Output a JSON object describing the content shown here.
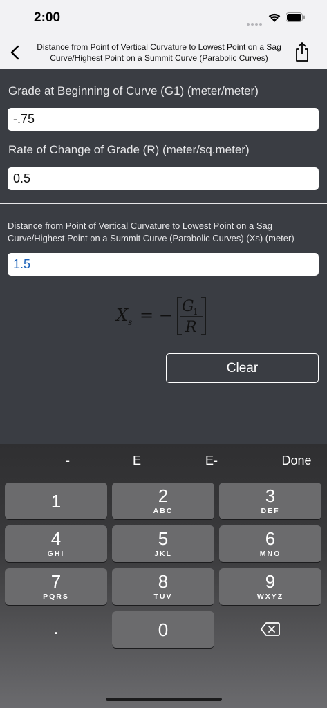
{
  "status_bar": {
    "time": "2:00"
  },
  "nav": {
    "title": "Distance from Point of Vertical Curvature to Lowest Point on a Sag Curve/Highest Point on a Summit Curve (Parabolic Curves)"
  },
  "form": {
    "g1_label": "Grade at Beginning of Curve (G1) (meter/meter)",
    "g1_value": "-.75",
    "r_label": "Rate of Change of Grade (R) (meter/sq.meter)",
    "r_value": "0.5",
    "result_label": "Distance from Point of Vertical Curvature to Lowest Point on a Sag Curve/Highest Point on a Summit Curve (Parabolic Curves) (Xs) (meter)",
    "result_value": "1.5",
    "clear_label": "Clear"
  },
  "formula": {
    "lhs": "X",
    "lhs_sub": "s",
    "eq": "= −",
    "num": "G",
    "num_sub": "1",
    "den": "R"
  },
  "keyboard": {
    "accessory": [
      "-",
      "E",
      "E-",
      "Done"
    ],
    "keys": [
      {
        "digit": "1",
        "letters": ""
      },
      {
        "digit": "2",
        "letters": "ABC"
      },
      {
        "digit": "3",
        "letters": "DEF"
      },
      {
        "digit": "4",
        "letters": "GHI"
      },
      {
        "digit": "5",
        "letters": "JKL"
      },
      {
        "digit": "6",
        "letters": "MNO"
      },
      {
        "digit": "7",
        "letters": "PQRS"
      },
      {
        "digit": "8",
        "letters": "TUV"
      },
      {
        "digit": "9",
        "letters": "WXYZ"
      }
    ],
    "dot": ".",
    "zero": "0",
    "delete_icon": "backspace-icon"
  }
}
